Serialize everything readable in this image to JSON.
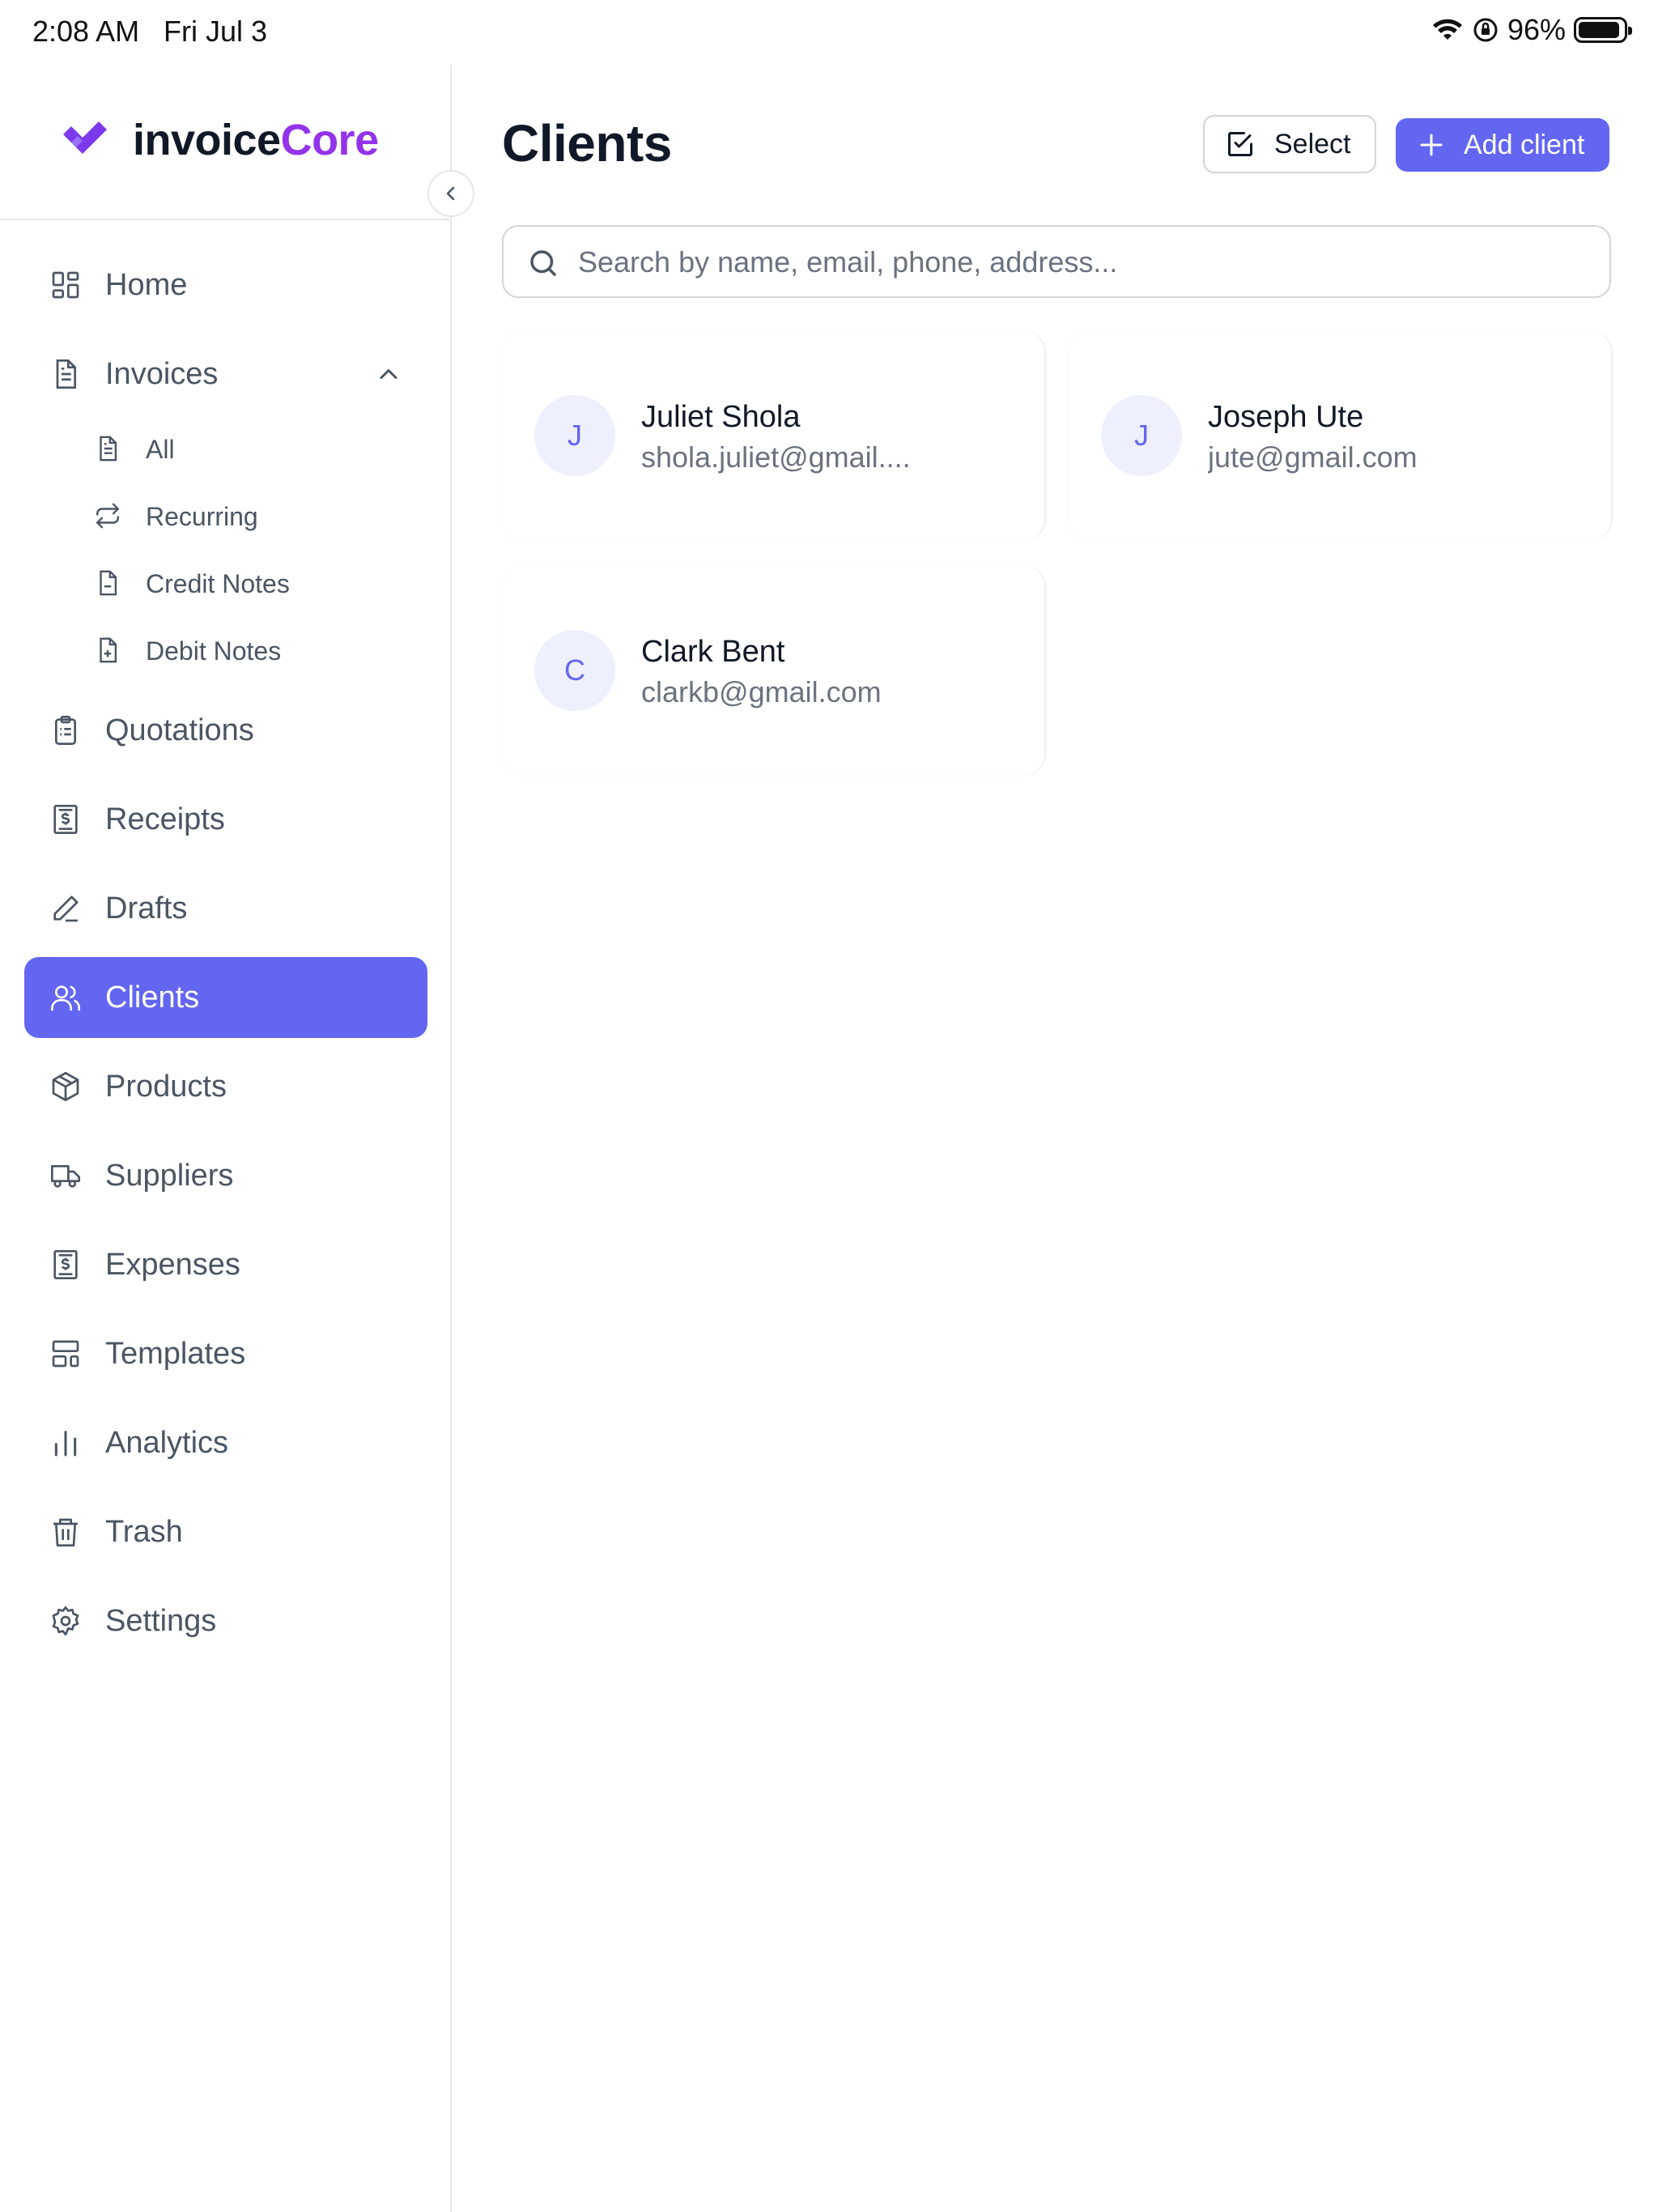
{
  "status_bar": {
    "time": "2:08 AM",
    "date": "Fri Jul 3",
    "battery": "96%"
  },
  "brand": {
    "name_part1": "invoice",
    "name_part2": "Core",
    "accent_color": "#9333ea",
    "mark_color": "#7c3aed"
  },
  "sidebar": {
    "items": [
      {
        "label": "Home",
        "icon": "grid-icon"
      },
      {
        "label": "Invoices",
        "icon": "document-icon"
      },
      {
        "label": "Quotations",
        "icon": "clipboard-icon"
      },
      {
        "label": "Receipts",
        "icon": "receipt-icon"
      },
      {
        "label": "Drafts",
        "icon": "pen-icon"
      },
      {
        "label": "Clients",
        "icon": "users-icon",
        "active": true
      },
      {
        "label": "Products",
        "icon": "box-icon"
      },
      {
        "label": "Suppliers",
        "icon": "truck-icon"
      },
      {
        "label": "Expenses",
        "icon": "receipt-icon"
      },
      {
        "label": "Templates",
        "icon": "layout-icon"
      },
      {
        "label": "Analytics",
        "icon": "bar-chart-icon"
      },
      {
        "label": "Trash",
        "icon": "trash-icon"
      },
      {
        "label": "Settings",
        "icon": "gear-icon"
      }
    ],
    "invoice_subitems": [
      {
        "label": "All",
        "icon": "document-icon"
      },
      {
        "label": "Recurring",
        "icon": "repeat-icon"
      },
      {
        "label": "Credit Notes",
        "icon": "credit-note-icon"
      },
      {
        "label": "Debit Notes",
        "icon": "debit-note-icon"
      }
    ]
  },
  "main": {
    "title": "Clients",
    "select_label": "Select",
    "add_label": "Add client",
    "search_placeholder": "Search by name, email, phone, address...",
    "accent_color": "#6366f1",
    "clients": [
      {
        "initial": "J",
        "name": "Juliet Shola",
        "email": "shola.juliet@gmail...."
      },
      {
        "initial": "J",
        "name": "Joseph Ute",
        "email": "jute@gmail.com"
      },
      {
        "initial": "C",
        "name": "Clark Bent",
        "email": "clarkb@gmail.com"
      }
    ]
  }
}
